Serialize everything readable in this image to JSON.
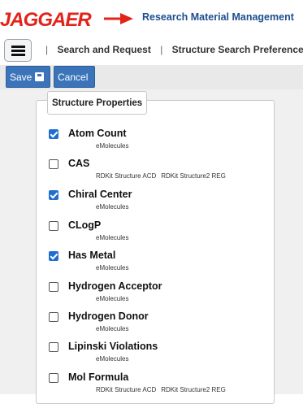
{
  "header": {
    "logo_text": "JAGGAER",
    "app_title": "Research Material Management"
  },
  "nav": {
    "crumbs": [
      "Search and Request",
      "Structure Search Preferences"
    ],
    "separator": "|"
  },
  "toolbar": {
    "save_label": "Save",
    "cancel_label": "Cancel"
  },
  "panel": {
    "legend": "Structure Properties",
    "properties": [
      {
        "name": "Atom Count",
        "checked": true,
        "sources": [
          "eMolecules"
        ]
      },
      {
        "name": "CAS",
        "checked": false,
        "sources": [
          "RDKit Structure ACD",
          "RDKit Structure2 REG"
        ]
      },
      {
        "name": "Chiral Center",
        "checked": true,
        "sources": [
          "eMolecules"
        ]
      },
      {
        "name": "CLogP",
        "checked": false,
        "sources": [
          "eMolecules"
        ]
      },
      {
        "name": "Has Metal",
        "checked": true,
        "sources": [
          "eMolecules"
        ]
      },
      {
        "name": "Hydrogen Acceptor",
        "checked": false,
        "sources": [
          "eMolecules"
        ]
      },
      {
        "name": "Hydrogen Donor",
        "checked": false,
        "sources": [
          "eMolecules"
        ]
      },
      {
        "name": "Lipinski Violations",
        "checked": false,
        "sources": [
          "eMolecules"
        ]
      },
      {
        "name": "Mol Formula",
        "checked": false,
        "sources": [
          "RDKit Structure ACD",
          "RDKit Structure2 REG"
        ]
      }
    ]
  },
  "colors": {
    "brand_red": "#e2231a",
    "title_blue": "#1d4e8f",
    "button_blue": "#3b74b8",
    "checkbox_blue": "#1f6fd1"
  }
}
